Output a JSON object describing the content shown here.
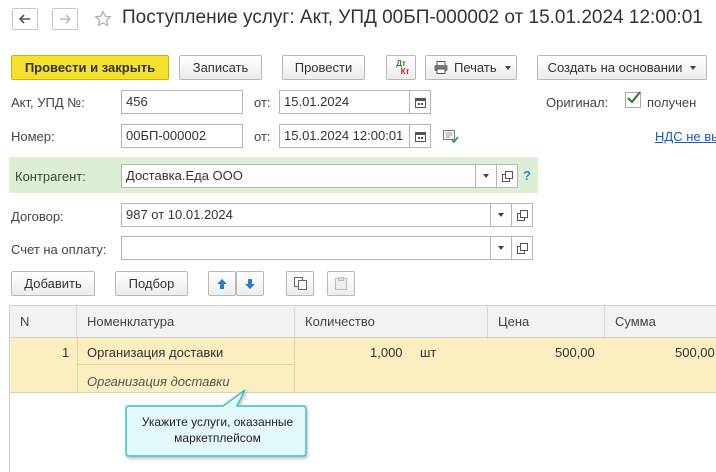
{
  "window": {
    "title": "Поступление услуг: Акт, УПД 00БП-000002 от 15.01.2024 12:00:01"
  },
  "toolbar": {
    "post_close": "Провести и закрыть",
    "save": "Записать",
    "post": "Провести",
    "dtkt_top": "Дт",
    "dtkt_bottom": "Кт",
    "print": "Печать",
    "create_based": "Создать на основании"
  },
  "form": {
    "act_label": "Акт, УПД №:",
    "act_value": "456",
    "date_label": "от:",
    "act_date": "15.01.2024",
    "original_label": "Оригинал:",
    "original_checked": "получен",
    "number_label": "Номер:",
    "number_value": "00БП-000002",
    "number_date": "15.01.2024 12:00:01",
    "vat_link": "НДС не вы",
    "counterparty_label": "Контрагент:",
    "counterparty_value": "Доставка.Еда ООО",
    "help": "?",
    "contract_label": "Договор:",
    "contract_value": "987 от 10.01.2024",
    "invoice_label": "Счет на оплату:",
    "invoice_value": ""
  },
  "table_toolbar": {
    "add": "Добавить",
    "select": "Подбор"
  },
  "table": {
    "columns": [
      "N",
      "Номенклатура",
      "Количество",
      "Цена",
      "Сумма"
    ],
    "rows": [
      {
        "n": "1",
        "item": "Организация доставки",
        "item_sub": "Организация доставки",
        "qty": "1,000",
        "unit": "шт",
        "price": "500,00",
        "sum": "500,00"
      }
    ]
  },
  "tooltip": {
    "text": "Укажите услуги, оказанные маркетплейсом"
  },
  "colors": {
    "primary_button": "#f5e02e",
    "counterparty_bg": "#dcefd4",
    "row_highlight": "#fbeec1",
    "tooltip_bg": "#e3f8fa",
    "tooltip_border": "#3fbcc8",
    "link": "#1a5bb8"
  }
}
